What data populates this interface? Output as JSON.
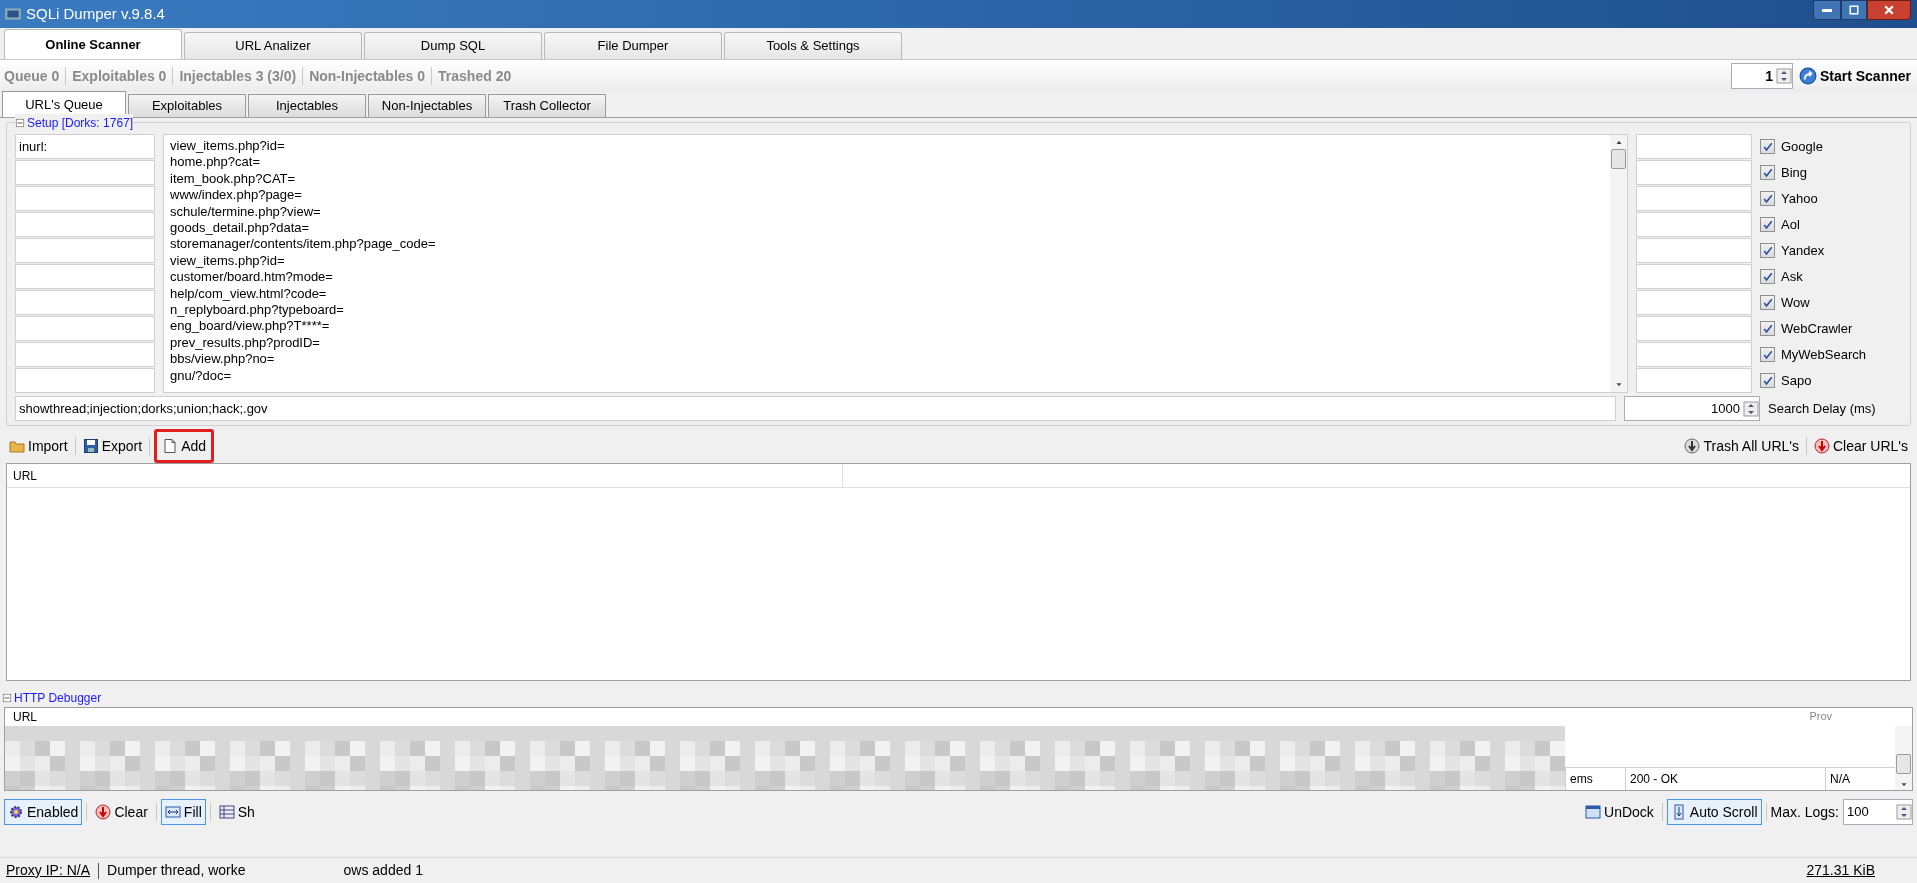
{
  "window": {
    "title": "SQLi Dumper v.9.8.4"
  },
  "main_tabs": [
    {
      "label": "Online Scanner",
      "selected": true
    },
    {
      "label": "URL Analizer",
      "selected": false
    },
    {
      "label": "Dump SQL",
      "selected": false
    },
    {
      "label": "File Dumper",
      "selected": false
    },
    {
      "label": "Tools & Settings",
      "selected": false
    }
  ],
  "stats": [
    "Queue 0",
    "Exploitables 0",
    "Injectables 3 (3/0)",
    "Non-Injectables 0",
    "Trashed 20"
  ],
  "scanner": {
    "threads": "1",
    "start_button": "Start Scanner"
  },
  "sub_tabs": [
    {
      "label": "URL's Queue",
      "selected": true
    },
    {
      "label": "Exploitables",
      "selected": false
    },
    {
      "label": "Injectables",
      "selected": false
    },
    {
      "label": "Non-Injectables",
      "selected": false
    },
    {
      "label": "Trash Collector",
      "selected": false
    }
  ],
  "setup": {
    "title": "Setup [Dorks: 1767]",
    "prefix": "inurl:",
    "dorks": [
      "view_items.php?id=",
      "home.php?cat=",
      "item_book.php?CAT=",
      "www/index.php?page=",
      "schule/termine.php?view=",
      "goods_detail.php?data=",
      "storemanager/contents/item.php?page_code=",
      "view_items.php?id=",
      "customer/board.htm?mode=",
      "help/com_view.html?code=",
      "n_replyboard.php?typeboard=",
      "eng_board/view.php?T****=",
      "prev_results.php?prodID=",
      "bbs/view.php?no=",
      "gnu/?doc="
    ],
    "engines": [
      {
        "label": "Google",
        "checked": true
      },
      {
        "label": "Bing",
        "checked": true
      },
      {
        "label": "Yahoo",
        "checked": true
      },
      {
        "label": "Aol",
        "checked": true
      },
      {
        "label": "Yandex",
        "checked": true
      },
      {
        "label": "Ask",
        "checked": true
      },
      {
        "label": "Wow",
        "checked": true
      },
      {
        "label": "WebCrawler",
        "checked": true
      },
      {
        "label": "MyWebSearch",
        "checked": true
      },
      {
        "label": "Sapo",
        "checked": true
      }
    ],
    "exclude": "showthread;injection;dorks;union;hack;.gov",
    "delay": "1000",
    "delay_label": "Search Delay (ms)"
  },
  "url_toolbar": {
    "left": [
      {
        "label": "Import",
        "kind": "folder",
        "highlighted": false
      },
      {
        "label": "Export",
        "kind": "save",
        "highlighted": false
      },
      {
        "label": "Add",
        "kind": "page",
        "highlighted": true
      }
    ],
    "right": [
      {
        "label": "Trash All URL's",
        "kind": "trash"
      },
      {
        "label": "Clear URL's",
        "kind": "clear"
      }
    ]
  },
  "url_table": {
    "columns": [
      "URL"
    ]
  },
  "debugger": {
    "title": "HTTP Debugger",
    "columns": [
      "URL",
      "Prov"
    ],
    "last_row": [
      "ems",
      "200 - OK",
      "N/A"
    ],
    "left_tools": [
      {
        "label": "Enabled",
        "kind": "gear",
        "on": true
      },
      {
        "label": "Clear",
        "kind": "clear",
        "on": false
      },
      {
        "label": "Fill",
        "kind": "fill",
        "on": true
      },
      {
        "label": "Sh",
        "kind": "list",
        "on": false
      }
    ],
    "right_tools": [
      {
        "label": "UnDock",
        "kind": "window",
        "on": false
      },
      {
        "label": "Auto Scroll",
        "kind": "down",
        "on": true
      }
    ],
    "max_logs_label": "Max. Logs:",
    "max_logs": "100"
  },
  "status_bar": {
    "proxy": "Proxy IP: N/A",
    "message": "Dumper thread, worke",
    "message_end": "ows added 1",
    "size": "271.31 KiB"
  }
}
